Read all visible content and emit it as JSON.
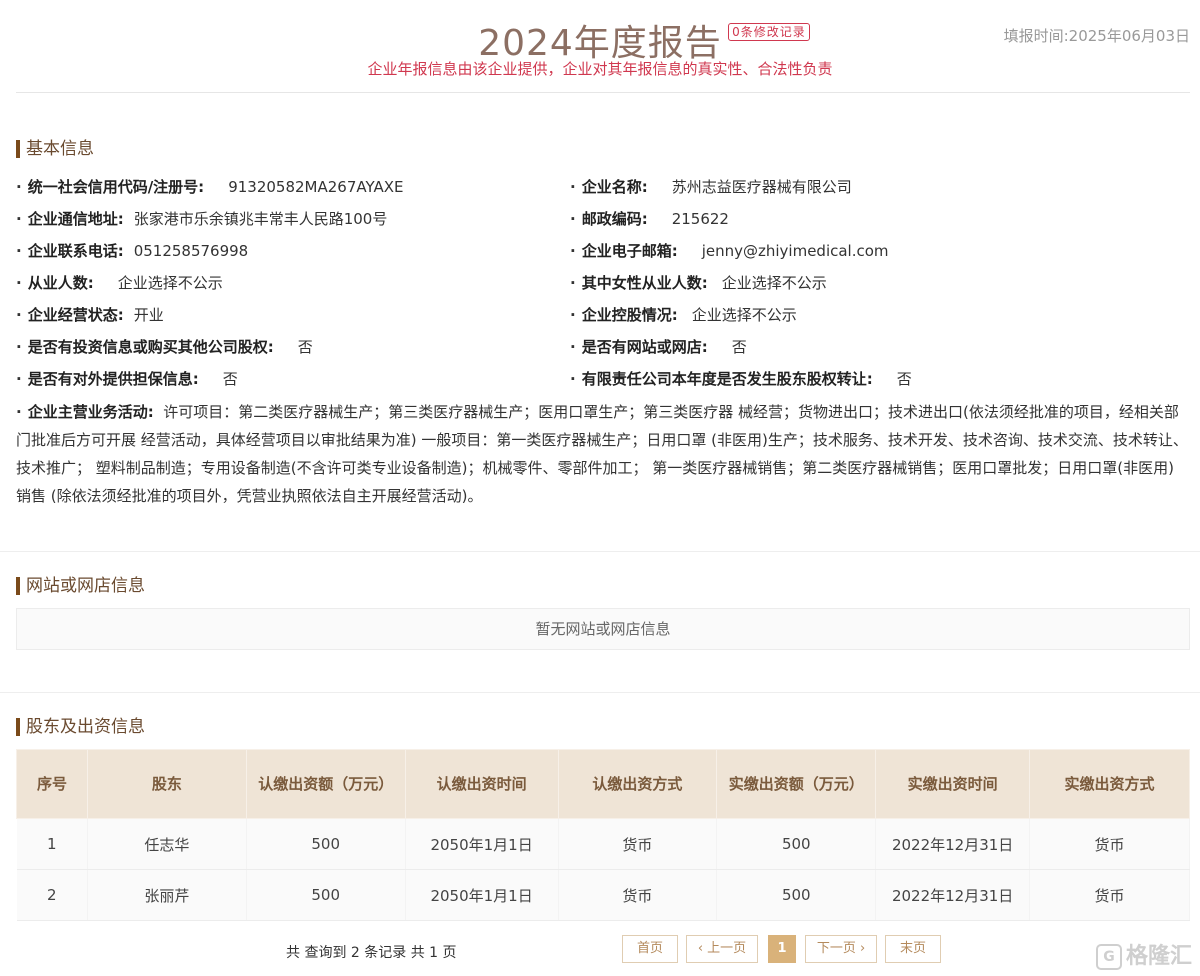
{
  "header": {
    "title": "2024年度报告",
    "modify_badge": "0条修改记录",
    "fill_date": "填报时间:2025年06月03日",
    "subtitle": "企业年报信息由该企业提供，企业对其年报信息的真实性、合法性负责"
  },
  "basic": {
    "section_title": "基本信息",
    "left": [
      {
        "label": "统一社会信用代码/注册号:",
        "value": "91320582MA267AYAXE"
      },
      {
        "label": "企业通信地址:",
        "value": "张家港市乐余镇兆丰常丰人民路100号"
      },
      {
        "label": "企业联系电话:",
        "value": "051258576998"
      },
      {
        "label": "从业人数:",
        "value": "企业选择不公示"
      },
      {
        "label": "企业经营状态:",
        "value": "开业"
      },
      {
        "label": "是否有投资信息或购买其他公司股权:",
        "value": "否"
      },
      {
        "label": "是否有对外提供担保信息:",
        "value": "否"
      }
    ],
    "right": [
      {
        "label": "企业名称:",
        "value": "苏州志益医疗器械有限公司"
      },
      {
        "label": "邮政编码:",
        "value": "215622"
      },
      {
        "label": "企业电子邮箱:",
        "value": "jenny@zhiyimedical.com"
      },
      {
        "label": "其中女性从业人数:",
        "value": "企业选择不公示"
      },
      {
        "label": "企业控股情况:",
        "value": "企业选择不公示"
      },
      {
        "label": "是否有网站或网店:",
        "value": "否"
      },
      {
        "label": "有限责任公司本年度是否发生股东股权转让:",
        "value": "否"
      }
    ],
    "business_label": "企业主营业务活动:",
    "business_value": "许可项目：第二类医疗器械生产；第三类医疗器械生产；医用口罩生产；第三类医疗器 械经营；货物进出口；技术进出口(依法须经批准的项目，经相关部门批准后方可开展 经营活动，具体经营项目以审批结果为准) 一般项目：第一类医疗器械生产；日用口罩 (非医用)生产；技术服务、技术开发、技术咨询、技术交流、技术转让、技术推广； 塑料制品制造；专用设备制造(不含许可类专业设备制造)；机械零件、零部件加工； 第一类医疗器械销售；第二类医疗器械销售；医用口罩批发；日用口罩(非医用)销售 (除依法须经批准的项目外，凭营业执照依法自主开展经营活动)。"
  },
  "website": {
    "section_title": "网站或网店信息",
    "empty_text": "暂无网站或网店信息"
  },
  "shareholders": {
    "section_title": "股东及出资信息",
    "columns": [
      "序号",
      "股东",
      "认缴出资额（万元）",
      "认缴出资时间",
      "认缴出资方式",
      "实缴出资额（万元）",
      "实缴出资时间",
      "实缴出资方式"
    ],
    "rows": [
      [
        "1",
        "任志华",
        "500",
        "2050年1月1日",
        "货币",
        "500",
        "2022年12月31日",
        "货币"
      ],
      [
        "2",
        "张丽芹",
        "500",
        "2050年1月1日",
        "货币",
        "500",
        "2022年12月31日",
        "货币"
      ]
    ]
  },
  "pagination": {
    "info": "共 查询到 2 条记录 共 1 页",
    "first": "首页",
    "prev": "‹ 上一页",
    "current": "1",
    "next": "下一页 ›",
    "last": "末页"
  },
  "watermark": {
    "icon": "G",
    "text": "格隆汇"
  }
}
